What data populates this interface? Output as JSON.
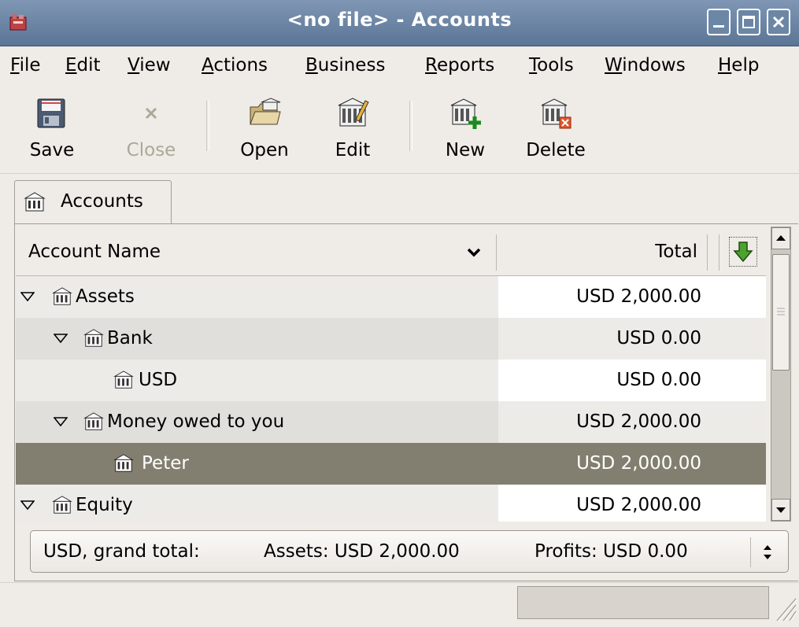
{
  "window": {
    "title": "<no file> - Accounts"
  },
  "menubar": {
    "items": [
      {
        "label": "File",
        "mnemonic": "F",
        "rest": "ile"
      },
      {
        "label": "Edit",
        "mnemonic": "E",
        "rest": "dit"
      },
      {
        "label": "View",
        "mnemonic": "V",
        "rest": "iew"
      },
      {
        "label": "Actions",
        "mnemonic": "A",
        "rest": "ctions"
      },
      {
        "label": "Business",
        "mnemonic": "B",
        "rest": "usiness"
      },
      {
        "label": "Reports",
        "mnemonic": "R",
        "rest": "eports"
      },
      {
        "label": "Tools",
        "mnemonic": "T",
        "rest": "ools"
      },
      {
        "label": "Windows",
        "mnemonic": "W",
        "rest": "indows"
      },
      {
        "label": "Help",
        "mnemonic": "H",
        "rest": "elp"
      }
    ]
  },
  "toolbar": {
    "save_label": "Save",
    "close_label": "Close",
    "open_label": "Open",
    "edit_label": "Edit",
    "new_label": "New",
    "delete_label": "Delete"
  },
  "tabs": [
    {
      "label": "Accounts",
      "icon": "account-icon"
    }
  ],
  "tree": {
    "col_name": "Account Name",
    "col_total": "Total",
    "rows": [
      {
        "name": "Assets",
        "total": "USD 2,000.00",
        "expanded": true
      },
      {
        "name": "Bank",
        "total": "USD 0.00",
        "expanded": true
      },
      {
        "name": "USD",
        "total": "USD 0.00"
      },
      {
        "name": "Money owed to you",
        "total": "USD 2,000.00",
        "expanded": true
      },
      {
        "name": "Peter",
        "total": "USD 2,000.00",
        "selected": true
      },
      {
        "name": "Equity",
        "total": "USD 2,000.00",
        "expanded": true
      }
    ]
  },
  "summary": {
    "label": "USD, grand total:",
    "assets": "Assets: USD 2,000.00",
    "profits": "Profits: USD 0.00"
  },
  "colors": {
    "titlebar": "#5b7596",
    "selection": "#837f70",
    "window_bg": "#efebe7"
  }
}
